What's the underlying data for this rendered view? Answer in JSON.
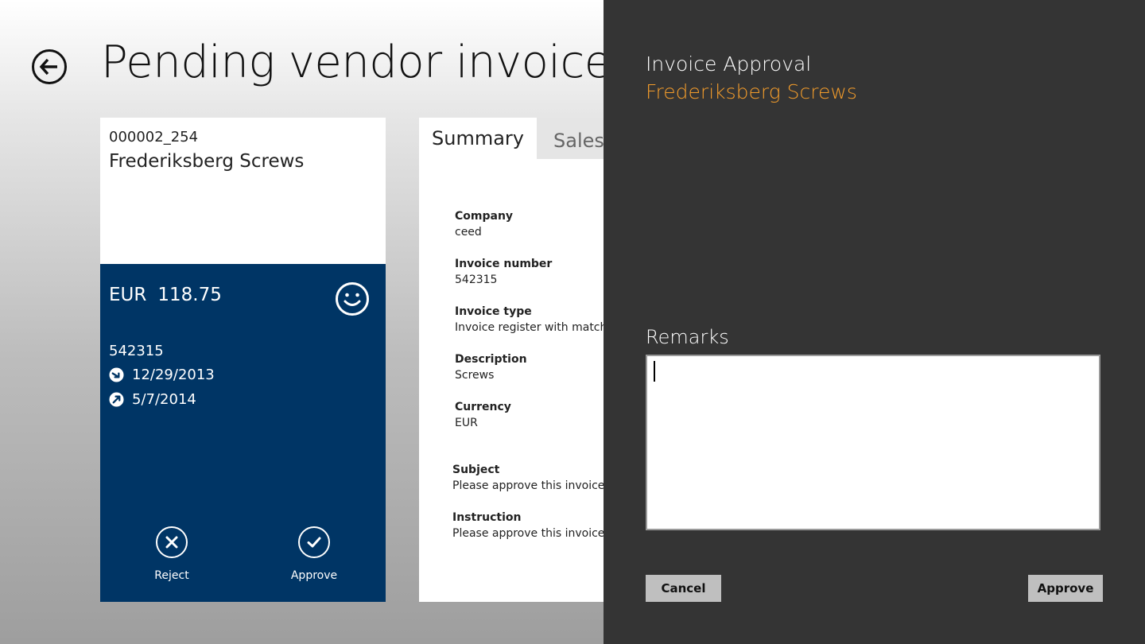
{
  "header": {
    "title": "Pending vendor invoice"
  },
  "card": {
    "id": "000002_254",
    "vendor": "Frederiksberg Screws",
    "currency": "EUR",
    "amount": "118.75",
    "invoice_number": "542315",
    "date_1": "12/29/2013",
    "date_2": "5/7/2014",
    "reject_label": "Reject",
    "approve_label": "Approve"
  },
  "tabs": [
    {
      "label": "Summary"
    },
    {
      "label": "Sales"
    }
  ],
  "summary": {
    "fields": [
      {
        "label": "Company",
        "value": "ceed"
      },
      {
        "label": "Invoice number",
        "value": "542315"
      },
      {
        "label": "Invoice type",
        "value": "Invoice register with matchin"
      },
      {
        "label": "Description",
        "value": "Screws"
      },
      {
        "label": "Currency",
        "value": "EUR"
      },
      {
        "label": "Subject",
        "value": "Please approve this invoice"
      },
      {
        "label": "Instruction",
        "value": "Please approve this invoice. N"
      }
    ]
  },
  "flyout": {
    "title": "Invoice Approval",
    "subtitle": "Frederiksberg Screws",
    "remarks_label": "Remarks",
    "remarks_value": "",
    "cancel_label": "Cancel",
    "approve_label": "Approve",
    "accent_color": "#f39c2b"
  },
  "colors": {
    "card_blue": "#003565",
    "flyout_bg": "#343434"
  }
}
